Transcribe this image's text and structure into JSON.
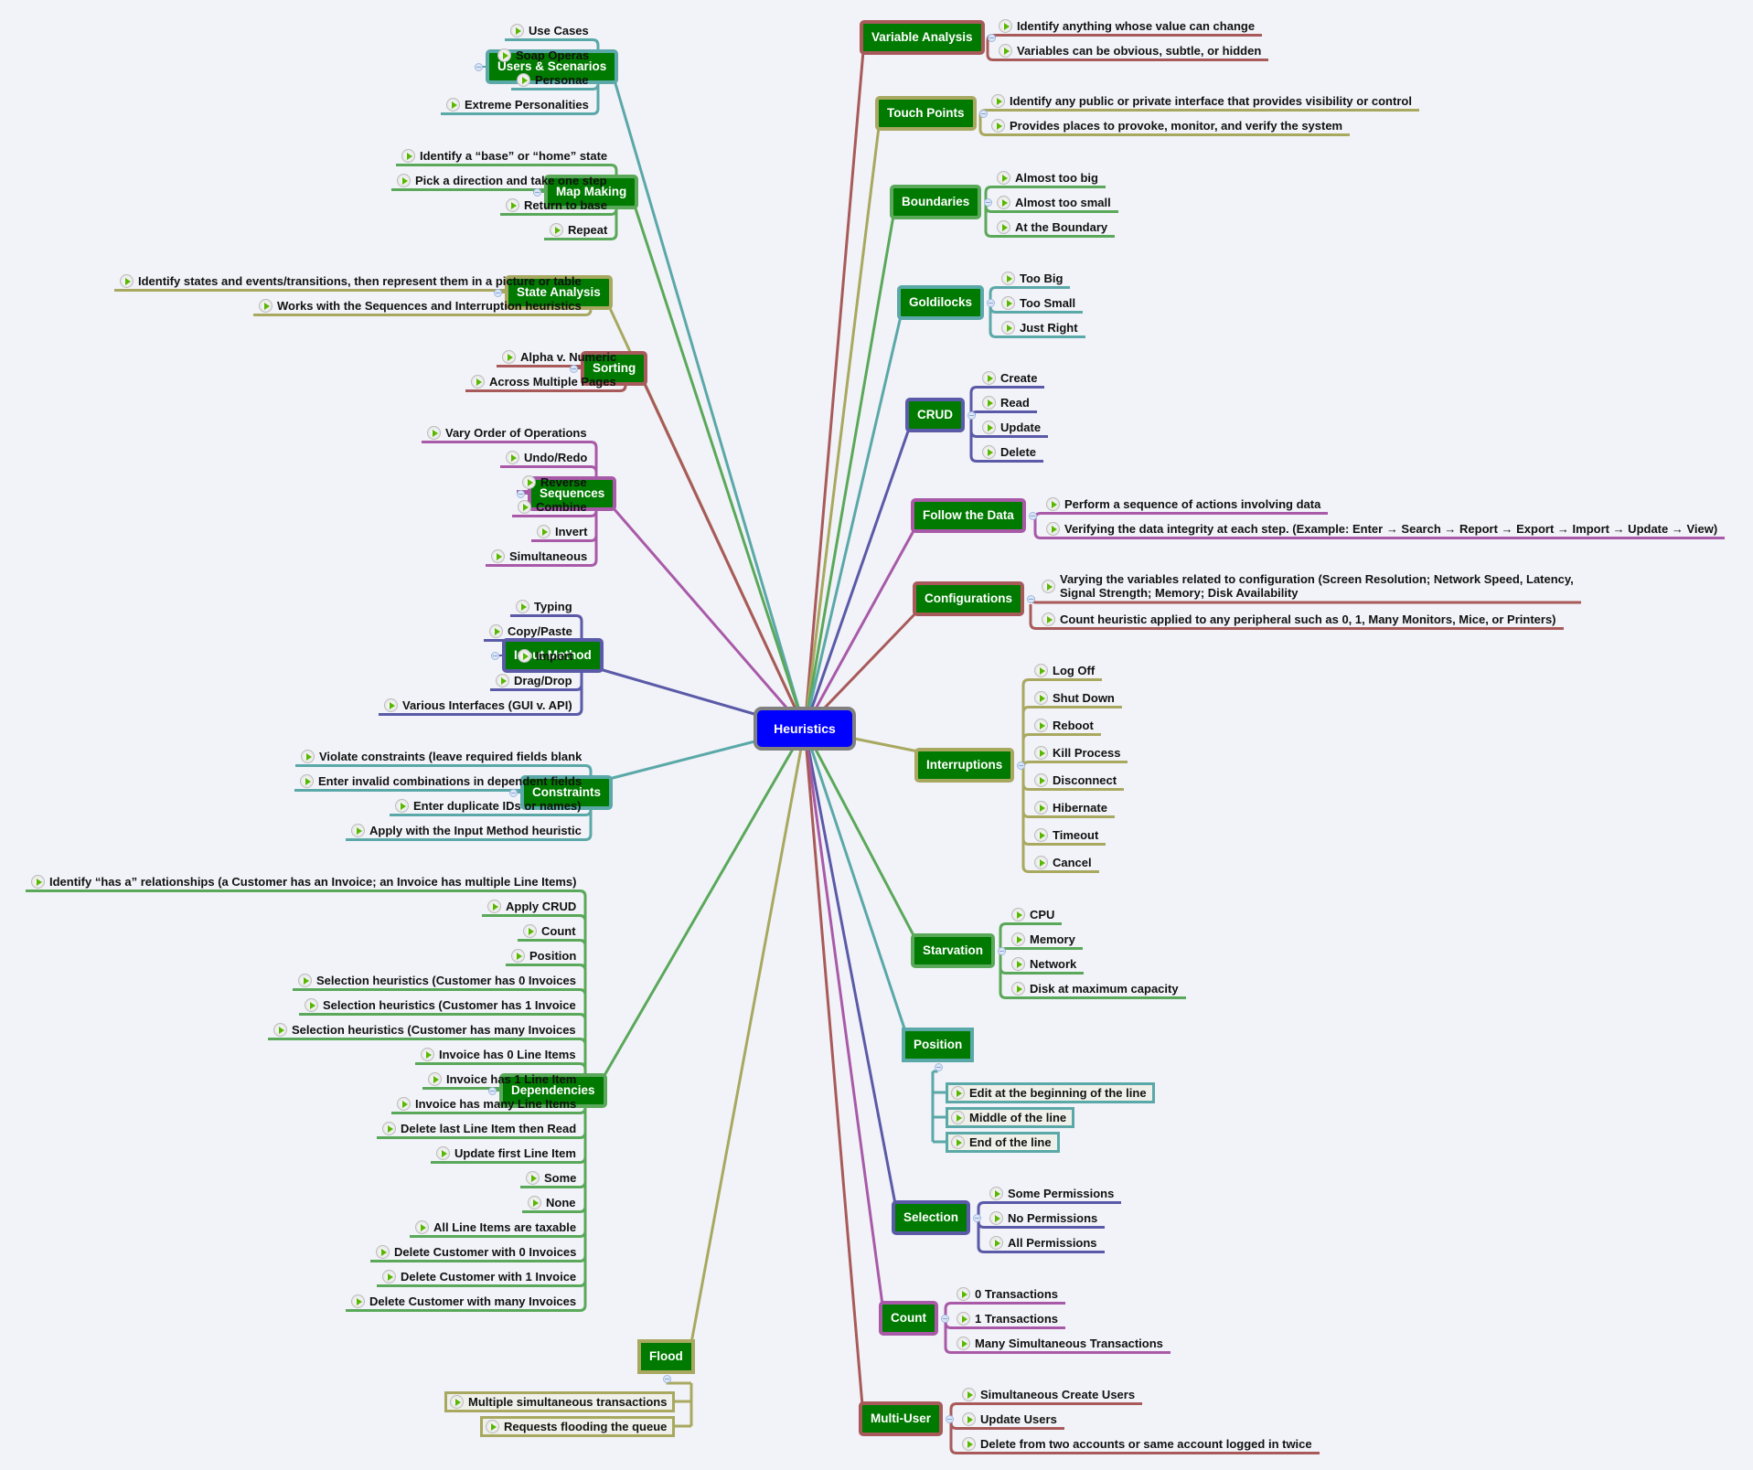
{
  "root": {
    "label": "Heuristics",
    "color": "#0000ff"
  },
  "colors": {
    "red": "#a85a5a",
    "olive": "#a8a860",
    "green": "#5aa85a",
    "teal": "#5aa8a8",
    "indigo": "#5a5aa8",
    "purple": "#a85aa8",
    "node_fill": "#007a00",
    "root_border": "#808080"
  },
  "branches": [
    {
      "label": "Users & Scenarios",
      "side": "left",
      "color": "teal",
      "children": [
        "Use Cases",
        "Soap Operas",
        "Personae",
        "Extreme Personalities"
      ]
    },
    {
      "label": "Map Making",
      "side": "left",
      "color": "green",
      "children": [
        "Identify a “base” or “home” state",
        "Pick a direction and take one step",
        "Return to base",
        "Repeat"
      ]
    },
    {
      "label": "State Analysis",
      "side": "left",
      "color": "olive",
      "children": [
        "Identify states and events/transitions, then represent them in a picture or table",
        "Works with the Sequences and Interruption heuristics"
      ]
    },
    {
      "label": "Sorting",
      "side": "left",
      "color": "red",
      "children": [
        "Alpha v. Numeric",
        "Across Multiple Pages"
      ]
    },
    {
      "label": "Sequences",
      "side": "left",
      "color": "purple",
      "children": [
        "Vary Order of Operations",
        "Undo/Redo",
        "Reverse",
        "Combine",
        "Invert",
        "Simultaneous"
      ]
    },
    {
      "label": "Input Method",
      "side": "left",
      "color": "indigo",
      "children": [
        "Typing",
        "Copy/Paste",
        "Import",
        "Drag/Drop",
        "Various Interfaces (GUI v. API)"
      ]
    },
    {
      "label": "Constraints",
      "side": "left",
      "color": "teal",
      "children": [
        "Violate constraints (leave required fields blank",
        "Enter invalid combinations in dependent fields",
        "Enter duplicate IDs or names)",
        "Apply with the Input Method heuristic"
      ]
    },
    {
      "label": "Dependencies",
      "side": "left",
      "color": "green",
      "children": [
        "Identify “has a” relationships (a Customer has an Invoice; an Invoice has multiple Line Items)",
        "Apply CRUD",
        "Count",
        "Position",
        "Selection heuristics (Customer has 0 Invoices",
        "Selection heuristics (Customer has 1 Invoice",
        "Selection heuristics (Customer has many Invoices",
        "Invoice has 0 Line Items",
        "Invoice has 1 Line Item",
        "Invoice has many Line Items",
        "Delete last Line Item then Read",
        "Update first Line Item",
        "Some",
        "None",
        "All Line Items are taxable",
        "Delete Customer with 0 Invoices",
        "Delete Customer with 1 Invoice",
        "Delete Customer with many Invoices"
      ]
    },
    {
      "label": "Flood",
      "side": "left",
      "color": "olive",
      "style": "boxed",
      "children": [
        "Multiple simultaneous transactions",
        "Requests flooding the queue"
      ]
    },
    {
      "label": "Variable Analysis",
      "side": "right",
      "color": "red",
      "children": [
        "Identify anything whose value can change",
        "Variables can be obvious, subtle, or hidden"
      ]
    },
    {
      "label": "Touch Points",
      "side": "right",
      "color": "olive",
      "children": [
        "Identify any public or private interface that provides visibility or control",
        "Provides places to provoke, monitor, and verify the system"
      ]
    },
    {
      "label": "Boundaries",
      "side": "right",
      "color": "green",
      "children": [
        "Almost too big",
        "Almost too small",
        "At the Boundary"
      ]
    },
    {
      "label": "Goldilocks",
      "side": "right",
      "color": "teal",
      "children": [
        "Too Big",
        "Too Small",
        "Just Right"
      ]
    },
    {
      "label": "CRUD",
      "side": "right",
      "color": "indigo",
      "children": [
        "Create",
        "Read",
        "Update",
        "Delete"
      ]
    },
    {
      "label": "Follow the Data",
      "side": "right",
      "color": "purple",
      "children": [
        "Perform a sequence of actions involving data",
        "Verifying the data integrity at each step. (Example: Enter → Search → Report → Export → Import → Update → View)"
      ]
    },
    {
      "label": "Configurations",
      "side": "right",
      "color": "red",
      "children": [
        "Varying the variables related to configuration (Screen Resolution; Network Speed, Latency,\nSignal Strength; Memory; Disk Availability",
        "Count heuristic applied to any peripheral such as 0, 1, Many Monitors, Mice, or Printers)"
      ]
    },
    {
      "label": "Interruptions",
      "side": "right",
      "color": "olive",
      "children": [
        "Log Off",
        "Shut Down",
        "Reboot",
        "Kill Process",
        "Disconnect",
        "Hibernate",
        "Timeout",
        "Cancel"
      ]
    },
    {
      "label": "Starvation",
      "side": "right",
      "color": "green",
      "children": [
        "CPU",
        "Memory",
        "Network",
        "Disk at maximum capacity"
      ]
    },
    {
      "label": "Position",
      "side": "right",
      "color": "teal",
      "style": "boxed",
      "children": [
        "Edit at the beginning of the line",
        "Middle of the line",
        "End of the line"
      ]
    },
    {
      "label": "Selection",
      "side": "right",
      "color": "indigo",
      "children": [
        "Some Permissions",
        "No Permissions",
        "All Permissions"
      ]
    },
    {
      "label": "Count",
      "side": "right",
      "color": "purple",
      "children": [
        "0 Transactions",
        "1 Transactions",
        "Many Simultaneous Transactions"
      ]
    },
    {
      "label": "Multi-User",
      "side": "right",
      "color": "red",
      "children": [
        "Simultaneous Create Users",
        "Update Users",
        "Delete from two accounts or same account logged in twice"
      ]
    }
  ]
}
